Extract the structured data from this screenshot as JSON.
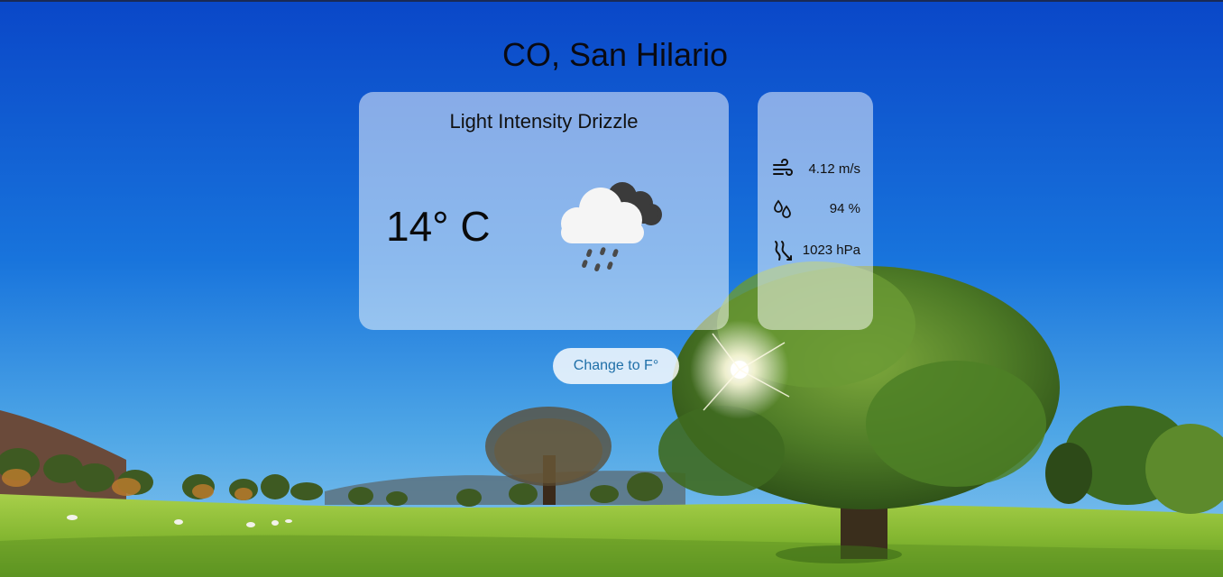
{
  "location": {
    "title": "CO, San Hilario"
  },
  "weather": {
    "condition": "Light Intensity Drizzle",
    "temperature": "14° C",
    "icon": "cloud-drizzle-icon"
  },
  "stats": {
    "wind": {
      "icon": "wind-icon",
      "value": "4.12 m/s"
    },
    "humidity": {
      "icon": "humidity-icon",
      "value": "94 %"
    },
    "pressure": {
      "icon": "pressure-icon",
      "value": "1023 hPa"
    }
  },
  "controls": {
    "unit_toggle_label": "Change to F°"
  },
  "colors": {
    "sky_top": "#0a4fd0",
    "sky_bottom": "#5aaee8",
    "grass": "#8fbf3a",
    "button_text": "#1f6fa8"
  }
}
